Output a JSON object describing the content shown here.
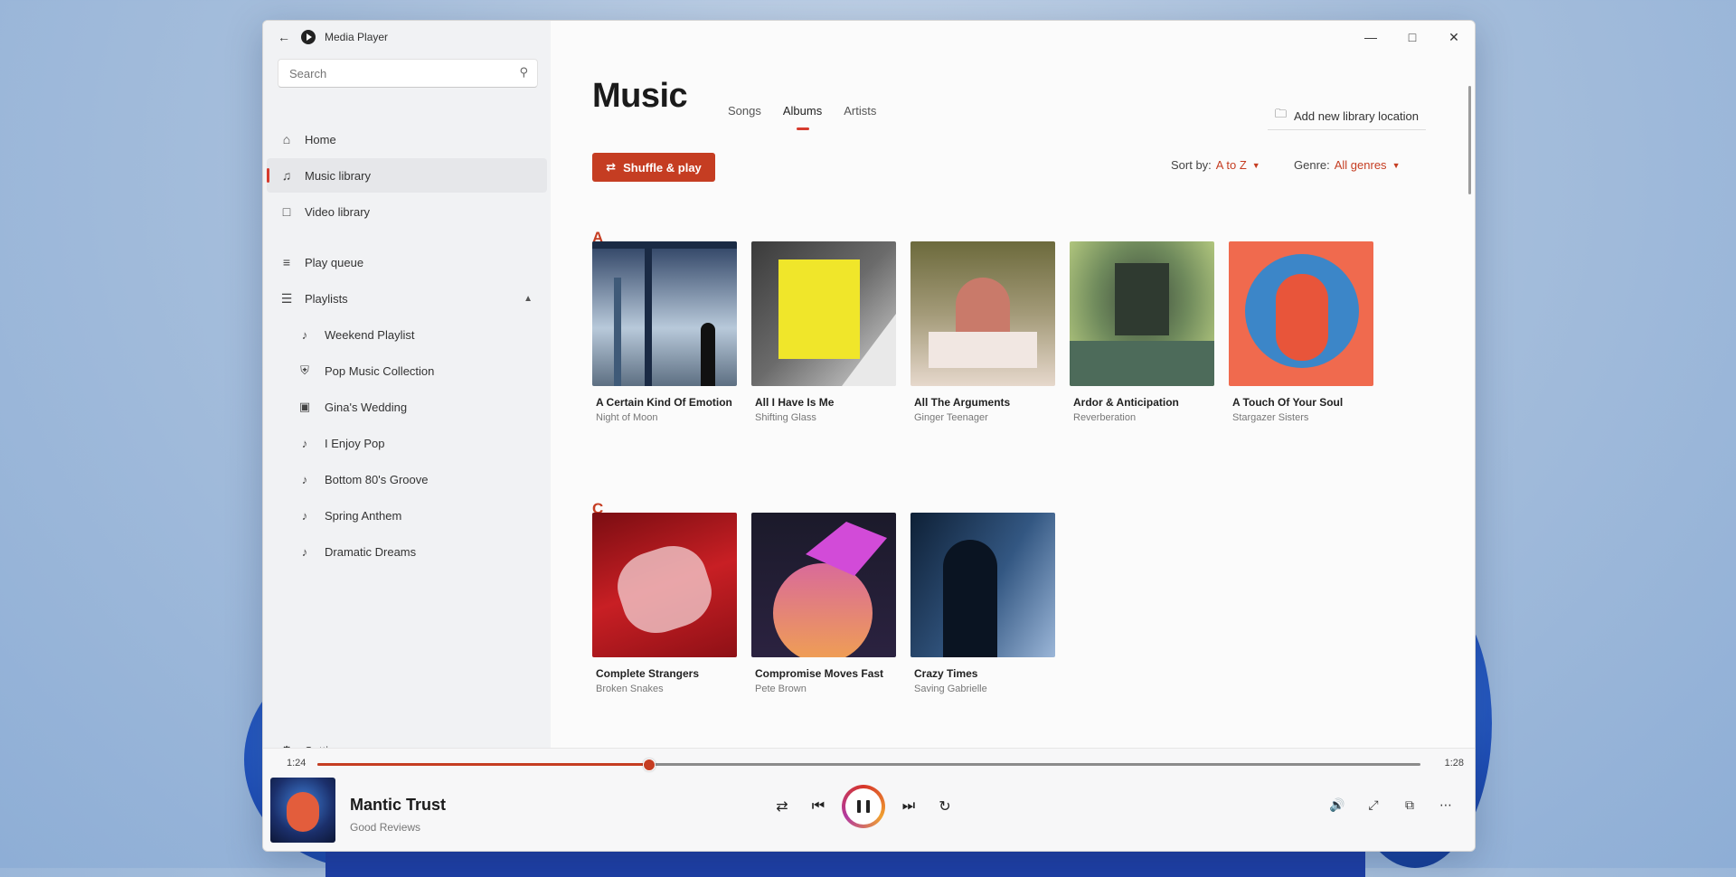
{
  "window": {
    "app_title": "Media Player"
  },
  "search": {
    "placeholder": "Search"
  },
  "sidebar": {
    "items": [
      {
        "label": "Home"
      },
      {
        "label": "Music library"
      },
      {
        "label": "Video library"
      },
      {
        "label": "Play queue"
      },
      {
        "label": "Playlists"
      }
    ],
    "playlists": [
      {
        "label": "Weekend Playlist"
      },
      {
        "label": "Pop Music Collection"
      },
      {
        "label": "Gina's Wedding"
      },
      {
        "label": "I Enjoy Pop"
      },
      {
        "label": "Bottom 80's Groove"
      },
      {
        "label": "Spring Anthem"
      },
      {
        "label": "Dramatic Dreams"
      }
    ],
    "settings_label": "Settings"
  },
  "main": {
    "title": "Music",
    "tabs": [
      "Songs",
      "Albums",
      "Artists"
    ],
    "add_location_label": "Add new library location",
    "shuffle_label": "Shuffle & play",
    "sort_label": "Sort by:",
    "sort_value": "A to Z",
    "genre_label": "Genre:",
    "genre_value": "All genres",
    "sections": [
      {
        "letter": "A",
        "albums": [
          {
            "title": "A Certain Kind Of Emotion",
            "artist": "Night of Moon"
          },
          {
            "title": "All I Have Is Me",
            "artist": "Shifting Glass"
          },
          {
            "title": "All The Arguments",
            "artist": "Ginger Teenager"
          },
          {
            "title": "Ardor & Anticipation",
            "artist": "Reverberation"
          },
          {
            "title": "A Touch Of Your Soul",
            "artist": "Stargazer Sisters"
          }
        ]
      },
      {
        "letter": "C",
        "albums": [
          {
            "title": "Complete Strangers",
            "artist": "Broken Snakes"
          },
          {
            "title": "Compromise Moves Fast",
            "artist": "Pete Brown"
          },
          {
            "title": "Crazy Times",
            "artist": "Saving Gabrielle"
          }
        ]
      }
    ]
  },
  "player": {
    "elapsed": "1:24",
    "duration": "1:28",
    "progress": 0.3,
    "now_title": "Mantic Trust",
    "now_artist": "Good Reviews"
  },
  "colors": {
    "accent": "#c53d22"
  }
}
